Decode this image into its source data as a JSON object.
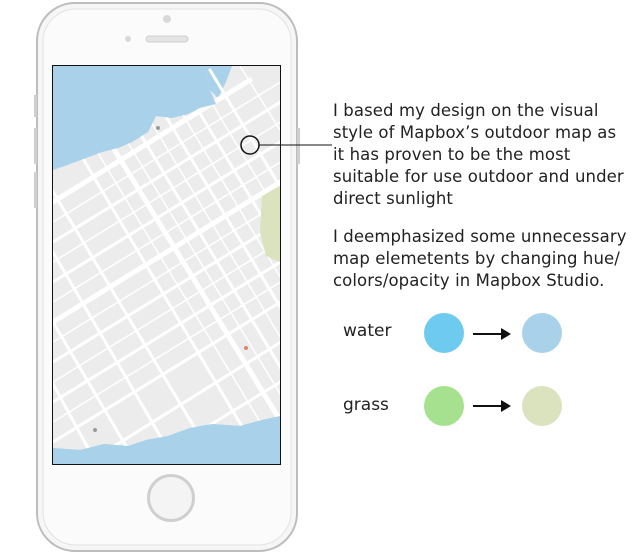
{
  "notes": {
    "paragraph1": "I based my design on the visual\nstyle of Mapbox’s outdoor map as\nit has proven to be the most\nsuitable for use outdoor and under\ndirect sunlight",
    "paragraph2": "I deemphasized some unnecessary\nmap elemetents by changing hue/\ncolors/opacity in Mapbox Studio."
  },
  "comparisons": [
    {
      "label": "water",
      "before_color": "#6ecbef",
      "after_color": "#a9d2ea"
    },
    {
      "label": "grass",
      "before_color": "#a6e190",
      "after_color": "#dbe3be"
    }
  ],
  "map": {
    "land_color": "#ececec",
    "road_color": "#ffffff",
    "water_color": "#a9d2ea",
    "park_color": "#dbe3be",
    "callout_marker": "circle-marker"
  },
  "icons": [
    "home-button-icon",
    "arrow-right-icon",
    "circle-marker-icon"
  ]
}
